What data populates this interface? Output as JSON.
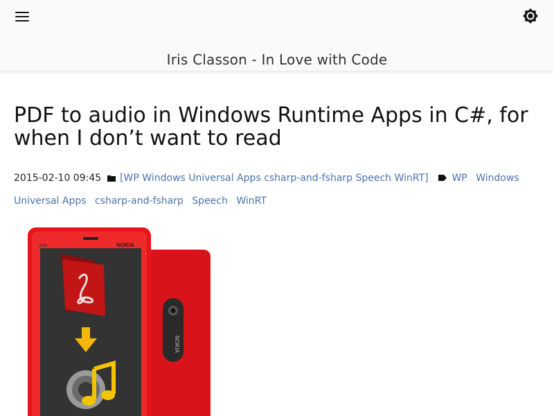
{
  "header": {
    "menu_icon": "hamburger-menu-icon",
    "theme_icon": "brightness-icon",
    "site_title": "Iris Classon - In Love with Code"
  },
  "post": {
    "title": "PDF to audio in Windows Runtime Apps in C#, for when I don’t want to read",
    "date": "2015-02-10 09:45",
    "category_link": "[WP Windows Universal Apps csharp-and-fsharp Speech WinRT]",
    "tags": [
      "WP",
      "Windows",
      "Universal Apps",
      "csharp-and-fsharp",
      "Speech",
      "WinRT"
    ],
    "image": {
      "description_icon": "phone-pdf-to-audio-illustration",
      "phone_brand_left": "at&t",
      "phone_brand_right": "NOKIA"
    }
  },
  "colors": {
    "link": "#4a72ad",
    "phone_red": "#e8141b",
    "header_bg": "#fafafa"
  }
}
